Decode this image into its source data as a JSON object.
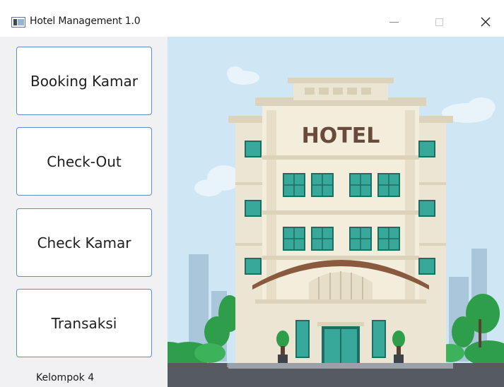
{
  "window": {
    "title": "Hotel Management 1.0",
    "controls": {
      "minimize": "—",
      "maximize": "□",
      "close": "✕"
    }
  },
  "sidebar": {
    "buttons": [
      {
        "label": "Booking Kamar"
      },
      {
        "label": "Check-Out"
      },
      {
        "label": "Check Kamar"
      },
      {
        "label": "Transaksi"
      }
    ],
    "footer": "Kelompok 4"
  },
  "illustration": {
    "sign_text": "HOTEL",
    "colors": {
      "sky": "#cfe6f4",
      "building": "#ece5d3",
      "building_shade": "#ddd3bb",
      "window": "#37a89a",
      "roof_arch": "#8a5a3f",
      "tree": "#2f9e4a",
      "street": "#555b61",
      "button_border": "#5b8fc6"
    }
  }
}
